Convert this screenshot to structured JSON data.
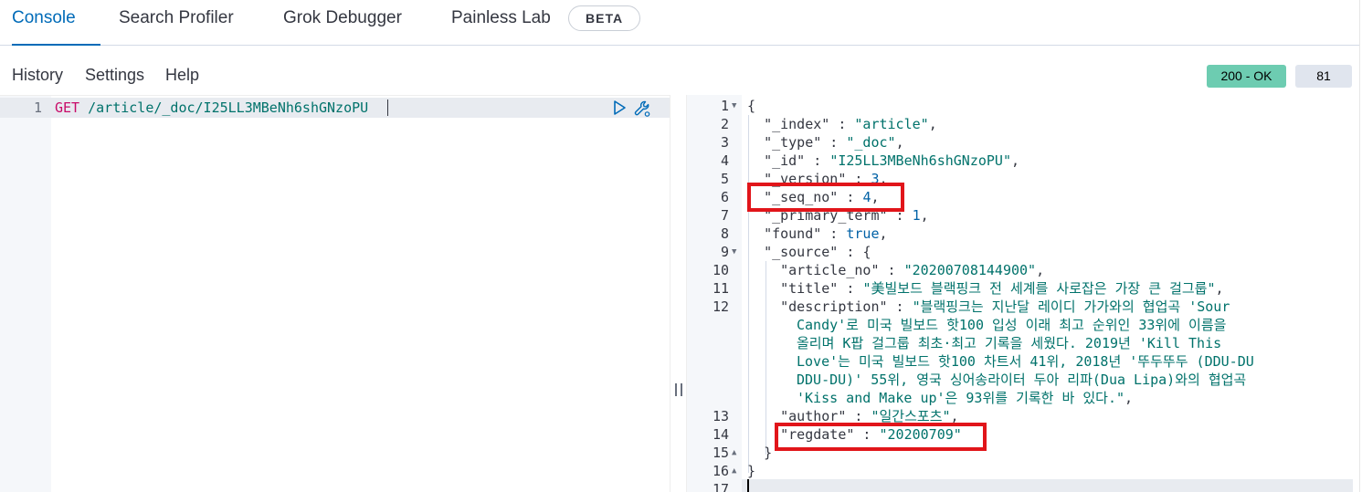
{
  "tabs": [
    {
      "label": "Console"
    },
    {
      "label": "Search Profiler"
    },
    {
      "label": "Grok Debugger"
    },
    {
      "label": "Painless Lab"
    }
  ],
  "beta_badge": "BETA",
  "menu": {
    "history": "History",
    "settings": "Settings",
    "help": "Help"
  },
  "status": {
    "code": "200 - OK",
    "time": "81 ms"
  },
  "request": {
    "line_number": "1",
    "method": "GET",
    "path": " /article/_doc/I25LL3MBeNh6shGNzoPU"
  },
  "response": {
    "line_numbers": [
      "1",
      "2",
      "3",
      "4",
      "5",
      "6",
      "7",
      "8",
      "9",
      "10",
      "11",
      "12",
      "13",
      "14",
      "15",
      "16",
      "17"
    ],
    "lines": {
      "l1": "{",
      "l2_key": "\"_index\"",
      "l2_val": "\"article\"",
      "l3_key": "\"_type\"",
      "l3_val": "\"_doc\"",
      "l4_key": "\"_id\"",
      "l4_val": "\"I25LL3MBeNh6shGNzoPU\"",
      "l5_key": "\"_version\"",
      "l5_val": "3",
      "l6_key": "\"_seq_no\"",
      "l6_val": "4",
      "l7_key": "\"_primary_term\"",
      "l7_val": "1",
      "l8_key": "\"found\"",
      "l8_val": "true",
      "l9_key": "\"_source\"",
      "l9_val": "{",
      "l10_key": "\"article_no\"",
      "l10_val": "\"20200708144900\"",
      "l11_key": "\"title\"",
      "l11_val": "\"美빌보드 블랙핑크 전 세계를 사로잡은 가장 큰 걸그룹\"",
      "l12_key": "\"description\"",
      "l12_val_1": "\"블랙핑크는 지난달 레이디 가가와의 협업곡 'Sour",
      "l12_val_2": "Candy'로 미국 빌보드 핫100 입성 이래 최고 순위인 33위에 이름을",
      "l12_val_3": "올리며 K팝 걸그룹 최초·최고 기록을 세웠다. 2019년 'Kill This",
      "l12_val_4": "Love'는 미국 빌보드 핫100 차트서 41위, 2018년 '뚜두뚜두 (DDU-DU",
      "l12_val_5": "DDU-DU)' 55위, 영국 싱어송라이터 두아 리파(Dua Lipa)와의 협업곡",
      "l12_val_6": "'Kiss and Make up'은 93위를 기록한 바 있다.\"",
      "l13_key": "\"author\"",
      "l13_val": "\"일간스포츠\"",
      "l14_key": "\"regdate\"",
      "l14_val": "\"20200709\"",
      "l15": "}",
      "l16": "}"
    }
  },
  "icons": {
    "run": "play-icon",
    "wrench": "wrench-icon",
    "fold_open": "caret-down-icon",
    "fold_close": "caret-up-icon"
  },
  "colors": {
    "accent": "#006bb8",
    "status_ok": "#6dccb1",
    "highlight": "#e1151a",
    "string": "#00726b",
    "method": "#c80a68"
  }
}
